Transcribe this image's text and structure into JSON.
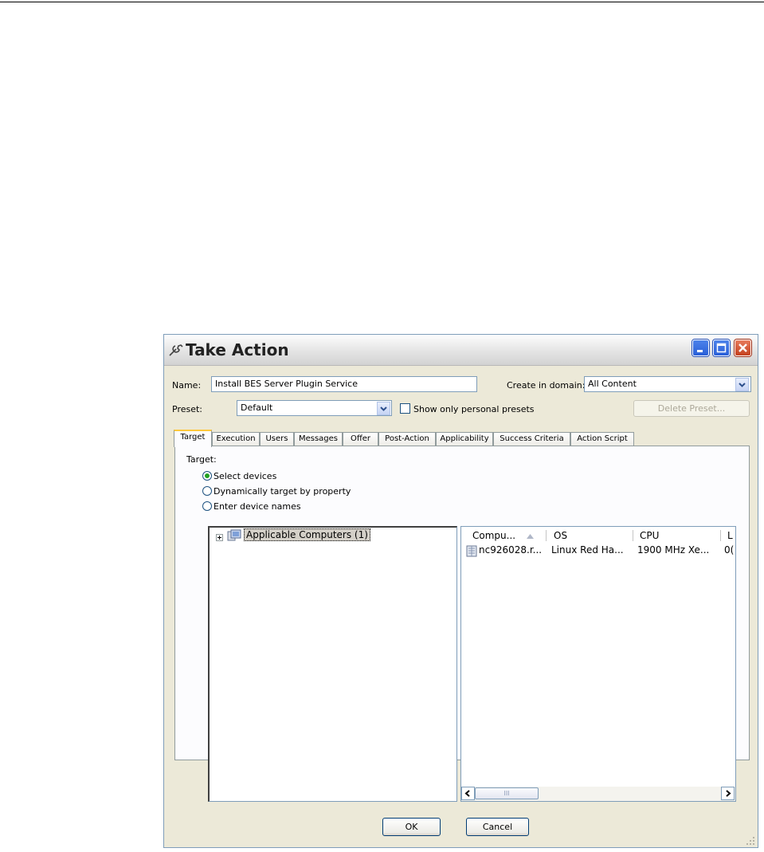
{
  "window": {
    "title": "Take Action"
  },
  "form": {
    "name_label": "Name:",
    "name_value": "Install BES Server Plugin Service",
    "domain_label": "Create in domain:",
    "domain_value": "All Content",
    "preset_label": "Preset:",
    "preset_value": "Default",
    "personal_presets_label": "Show only personal presets",
    "personal_presets_checked": false,
    "delete_preset_label": "Delete Preset..."
  },
  "tabs": [
    {
      "label": "Target",
      "active": true
    },
    {
      "label": "Execution"
    },
    {
      "label": "Users"
    },
    {
      "label": "Messages"
    },
    {
      "label": "Offer"
    },
    {
      "label": "Post-Action"
    },
    {
      "label": "Applicability"
    },
    {
      "label": "Success Criteria"
    },
    {
      "label": "Action Script"
    }
  ],
  "target": {
    "heading": "Target:",
    "options": [
      {
        "label": "Select devices",
        "selected": true
      },
      {
        "label": "Dynamically target by property",
        "selected": false
      },
      {
        "label": "Enter device names",
        "selected": false
      }
    ]
  },
  "tree": {
    "root_label": "Applicable Computers (1)"
  },
  "list": {
    "columns": [
      "Compu...",
      "OS",
      "CPU",
      "L"
    ],
    "rows": [
      [
        "nc926028.r...",
        "Linux Red Ha...",
        "1900 MHz Xe...",
        "0("
      ]
    ],
    "scroll_grip": "III"
  },
  "buttons": {
    "ok": "OK",
    "cancel": "Cancel"
  }
}
